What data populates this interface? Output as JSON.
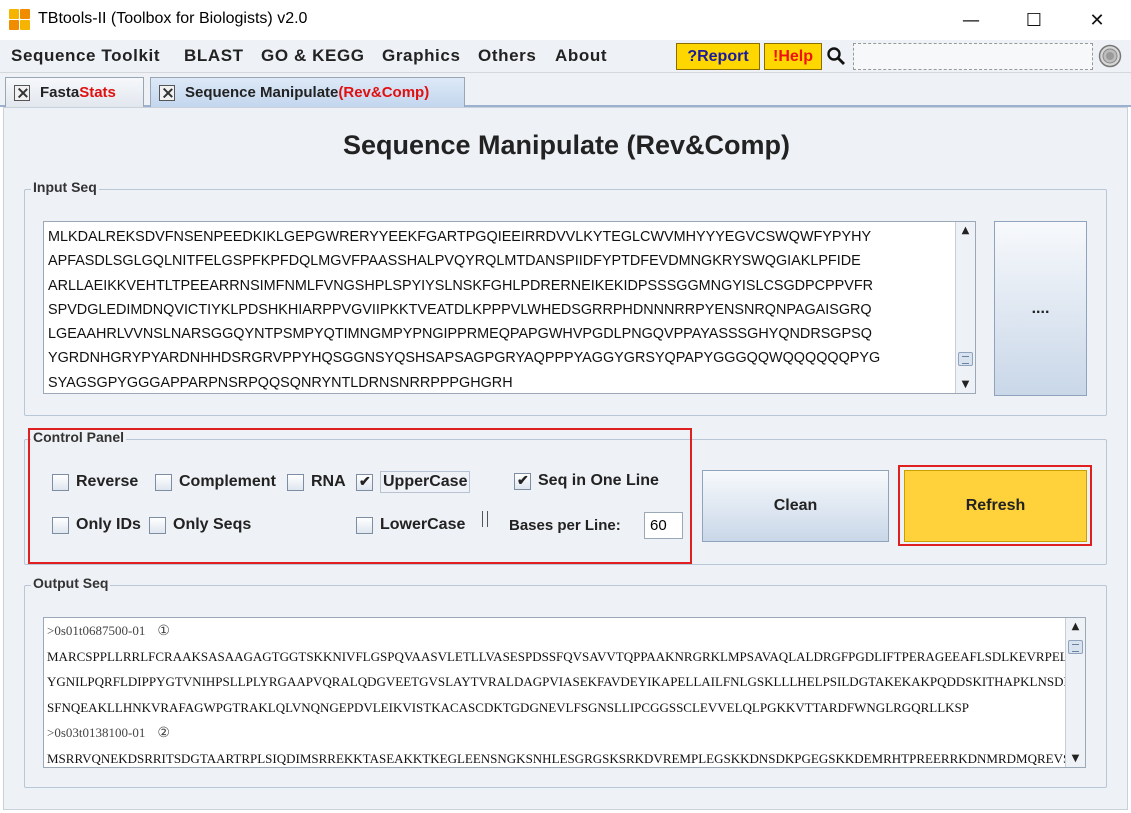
{
  "window": {
    "title": "TBtools-II (Toolbox for Biologists) v2.0",
    "minimize": "—",
    "maximize": "☐",
    "close": "✕"
  },
  "menu": {
    "items": [
      "Sequence Toolkit",
      "BLAST",
      "GO & KEGG",
      "Graphics",
      "Others",
      "About"
    ],
    "report_label": "?Report",
    "help_label": "!Help",
    "search_value": ""
  },
  "tabs": [
    {
      "label_main": "Fasta ",
      "label_accent": "Stats",
      "active": false
    },
    {
      "label_main": "Sequence Manipulate ",
      "label_accent": "(Rev&Comp)",
      "active": true
    }
  ],
  "page": {
    "title": "Sequence Manipulate (Rev&Comp)"
  },
  "input": {
    "label": "Input Seq",
    "lines": [
      "MLKDALREKSDVFNSENPEEDKIKLGEPGWRERYYEEKFGARTPGQIEEIRRDVVLKYTEGLCWVMHYYYEGVCSWQWFYPYHY",
      "APFASDLSGLGQLNITFELGSPFKPFDQLMGVFPAASSHALPVQYRQLMTDANSPIIDFYPTDFEVDMNGKRYSWQGIAKLPFIDE",
      "ARLLAEIKKVEHTLTPEEARRNSIMFNMLFVNGSHPLSPYIYSLNSKFGHLPDRERNEIKEKIDPSSSGGMNGYISLCSGDPCPPVFR",
      "SPVDGLEDIMDNQVICTIYKLPDSHKHIARPPVGVIIPKKTVEATDLKPPPVLWHEDSGRRPHDNNNRRPYENSNRQNPAGAISGRQ",
      "LGEAAHRLVVNSLNARSGGQYNTPSMPYQTIMNGMPYPNGIPPRMEQPAPGWHVPGDLPNGQVPPAYASSSGHYQNDRSGPSQ",
      "YGRDNHGRYPYARDNHHDSRGRVPPYHQSGGNSYQSHSAPSAGPGRYAQPPPYAGGYGRSYQPAPYGGGQQWQQQQQQPYG",
      "SYAGSGPYGGGAPPARPNSRPQQSQNRYNTLDRNSNRRPPPGHGRH"
    ],
    "browse_label": "...."
  },
  "control": {
    "label": "Control Panel",
    "reverse": {
      "label": "Reverse",
      "checked": false
    },
    "complement": {
      "label": "Complement",
      "checked": false
    },
    "rna": {
      "label": "RNA",
      "checked": false
    },
    "uppercase": {
      "label": "UpperCase",
      "checked": true
    },
    "seq_one_line": {
      "label": "Seq in One Line",
      "checked": true
    },
    "only_ids": {
      "label": "Only IDs",
      "checked": false
    },
    "only_seqs": {
      "label": "Only Seqs",
      "checked": false
    },
    "lowercase": {
      "label": "LowerCase",
      "checked": false
    },
    "bases_per_line_label": "Bases per Line:",
    "bases_per_line_value": "60",
    "clean_label": "Clean",
    "refresh_label": "Refresh"
  },
  "output": {
    "label": "Output Seq",
    "lines": [
      {
        "text": ">0s01t0687500-01",
        "mark": "①",
        "header": true
      },
      {
        "text": "MARCSPPLLRRLFCRAAKSASAAGAGTGGTSKKNIVFLGSPQVAASVLETLLVASESPDSSFQVSAVVTQPPAAKNRGRKLMPSAVAQLALDRGFPGDLIFTPERAGEEAFLSDLKEVRPELCITAA",
        "mark": "",
        "header": false
      },
      {
        "text": "YGNILPQRFLDIPPYGTVNIHPSLLPLYRGAAPVQRALQDGVEETGVSLAYTVRALDAGPVIASEKFAVDEYIKAPELLAILFNLGSKLLLHELPSILDGTAKEKAKPQDDSKITHAPKLNSDESWL",
        "mark": "",
        "header": false
      },
      {
        "text": "SFNQEAKLLHNKVRAFAGWPGTRAKLQLVNQNGEPDVLEIKVISTKACASCDKTGDGNEVLFSGNSLLIPCGGSSCLEVVELQLPGKKVTTARDFWNGLRGQRLLKSP",
        "mark": "",
        "header": false
      },
      {
        "text": ">0s03t0138100-01",
        "mark": "②",
        "header": true
      },
      {
        "text": "MSRRVQNEKDSRRITSDGTAARTRPLSIQDIMSRREKKTASEAKKTKEGLEENSNGKSNHLESGRGSKSRKDVREMPLEGSKKDNSDKPGEGSKKDEMRHTPREERRKDNMRDMQREVSKKDNLKDR",
        "mark": "",
        "header": false
      }
    ]
  },
  "icons": {
    "app": "tbtools-logo-icon",
    "search": "magnifier-icon",
    "settings": "settings-circle-icon",
    "tab_close": "close-box-icon"
  }
}
